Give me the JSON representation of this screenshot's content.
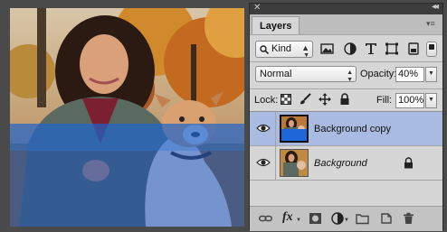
{
  "panel": {
    "tab_label": "Layers",
    "close_glyph": "✕",
    "collapse_glyph": "◂◂",
    "menu_glyph": "▾≡"
  },
  "filter": {
    "kind_label": "Kind",
    "icons": [
      "image-filter-icon",
      "adjustment-filter-icon",
      "type-filter-icon",
      "shape-filter-icon",
      "smart-object-filter-icon"
    ]
  },
  "blend": {
    "mode": "Normal",
    "opacity_label": "Opacity:",
    "opacity_value": "40%",
    "fill_label": "Fill:",
    "fill_value": "100%"
  },
  "lock": {
    "label": "Lock:",
    "icons": [
      "lock-transparent-icon",
      "lock-image-icon",
      "lock-position-icon",
      "lock-all-icon"
    ]
  },
  "layers": [
    {
      "name": "Background copy",
      "visible": true,
      "selected": true
    },
    {
      "name": "Background",
      "visible": true,
      "selected": false,
      "locked": true
    }
  ],
  "bottom_tools": [
    {
      "label": "fx"
    }
  ],
  "colors": {
    "selected_layer": "#a9bbe0",
    "overlay_blue": "#1650be",
    "panel_bg": "#d6d6d6"
  }
}
